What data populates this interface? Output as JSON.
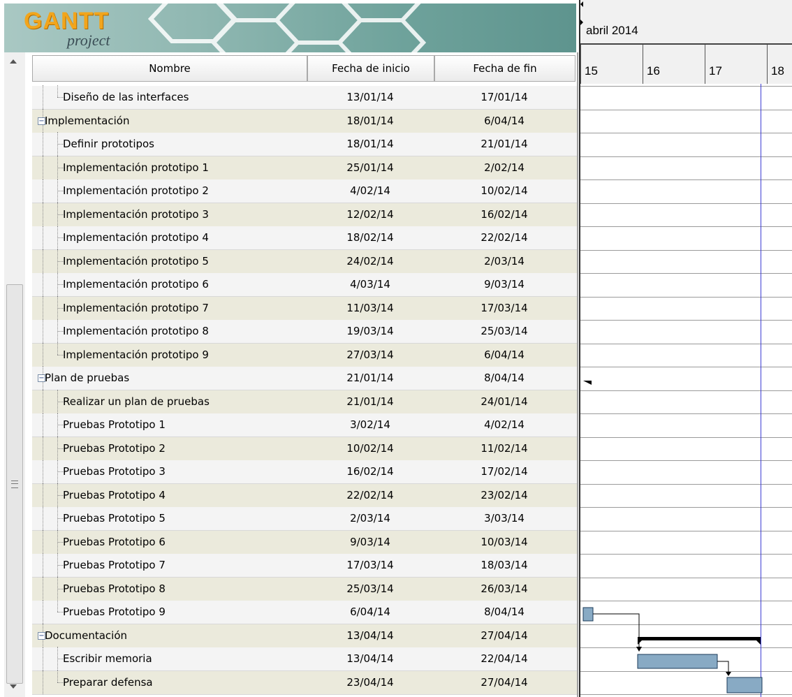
{
  "logo": {
    "text_main": "GANTT",
    "text_sub": "project"
  },
  "table": {
    "headers": {
      "name": "Nombre",
      "start": "Fecha de inicio",
      "end": "Fecha de fin"
    },
    "rows": [
      {
        "name": "Diseño de las interfaces",
        "start": "13/01/14",
        "end": "17/01/14",
        "level": 1
      },
      {
        "name": "Implementación",
        "start": "18/01/14",
        "end": "6/04/14",
        "level": 0
      },
      {
        "name": "Definir prototipos",
        "start": "18/01/14",
        "end": "21/01/14",
        "level": 1
      },
      {
        "name": "Implementación prototipo 1",
        "start": "25/01/14",
        "end": "2/02/14",
        "level": 1
      },
      {
        "name": "Implementación prototipo 2",
        "start": "4/02/14",
        "end": "10/02/14",
        "level": 1
      },
      {
        "name": "Implementación prototipo 3",
        "start": "12/02/14",
        "end": "16/02/14",
        "level": 1
      },
      {
        "name": "Implementación prototipo 4",
        "start": "18/02/14",
        "end": "22/02/14",
        "level": 1
      },
      {
        "name": "Implementación prototipo 5",
        "start": "24/02/14",
        "end": "2/03/14",
        "level": 1
      },
      {
        "name": "Implementación prototipo 6",
        "start": "4/03/14",
        "end": "9/03/14",
        "level": 1
      },
      {
        "name": "Implementación prototipo 7",
        "start": "11/03/14",
        "end": "17/03/14",
        "level": 1
      },
      {
        "name": "Implementación prototipo 8",
        "start": "19/03/14",
        "end": "25/03/14",
        "level": 1
      },
      {
        "name": "Implementación prototipo 9",
        "start": "27/03/14",
        "end": "6/04/14",
        "level": 1
      },
      {
        "name": "Plan de pruebas",
        "start": "21/01/14",
        "end": "8/04/14",
        "level": 0
      },
      {
        "name": "Realizar un plan de pruebas",
        "start": "21/01/14",
        "end": "24/01/14",
        "level": 1
      },
      {
        "name": "Pruebas Prototipo 1",
        "start": "3/02/14",
        "end": "4/02/14",
        "level": 1
      },
      {
        "name": "Pruebas Prototipo 2",
        "start": "10/02/14",
        "end": "11/02/14",
        "level": 1
      },
      {
        "name": "Pruebas Prototipo 3",
        "start": "16/02/14",
        "end": "17/02/14",
        "level": 1
      },
      {
        "name": "Pruebas Prototipo 4",
        "start": "22/02/14",
        "end": "23/02/14",
        "level": 1
      },
      {
        "name": "Pruebas Prototipo 5",
        "start": "2/03/14",
        "end": "3/03/14",
        "level": 1
      },
      {
        "name": "Pruebas Prototipo 6",
        "start": "9/03/14",
        "end": "10/03/14",
        "level": 1
      },
      {
        "name": "Pruebas Prototipo 7",
        "start": "17/03/14",
        "end": "18/03/14",
        "level": 1
      },
      {
        "name": "Pruebas Prototipo 8",
        "start": "25/03/14",
        "end": "26/03/14",
        "level": 1
      },
      {
        "name": "Pruebas Prototipo 9",
        "start": "6/04/14",
        "end": "8/04/14",
        "level": 1
      },
      {
        "name": "Documentación",
        "start": "13/04/14",
        "end": "27/04/14",
        "level": 0
      },
      {
        "name": "Escribir memoria",
        "start": "13/04/14",
        "end": "22/04/14",
        "level": 1
      },
      {
        "name": "Preparar defensa",
        "start": "23/04/14",
        "end": "27/04/14",
        "level": 1
      }
    ]
  },
  "gantt": {
    "month_label": "abril 2014",
    "days": [
      "15",
      "16",
      "17",
      "18"
    ]
  },
  "colors": {
    "task_bar": "#88aac4",
    "summary_bar": "#000000",
    "today_line": "#3d3dd4",
    "row_alt": "#ebeadc"
  }
}
